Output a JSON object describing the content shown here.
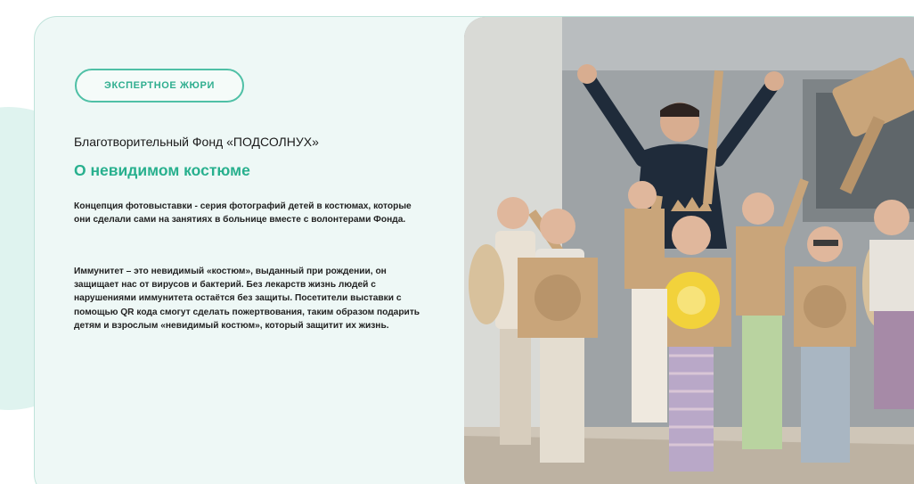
{
  "badge": {
    "label": "ЭКСПЕРТНОЕ ЖЮРИ"
  },
  "organization": "Благотворительный Фонд «ПОДСОЛНУХ»",
  "title": "О невидимом костюме",
  "paragraphs": [
    "Концепция фотовыставки - серия фотографий детей в костюмах, которые они сделали сами на занятиях в больнице вместе с волонтерами Фонда.",
    "Иммунитет – это невидимый «костюм», выданный при рождении, он защищает нас от вирусов и бактерий. Без лекарств жизнь людей с нарушениями иммунитета остаётся без защиты. Посетители выставки с помощью QR кода смогут сделать пожертвования, таким образом подарить детям и взрослым «невидимый костюм», который защитит их жизнь."
  ],
  "colors": {
    "accent": "#2fae8f",
    "card_bg": "#eef8f6",
    "badge_border": "#4fc0a6",
    "cardboard": "#c9a57a"
  },
  "photo": {
    "icon": "children-in-cardboard-costumes-photo"
  }
}
